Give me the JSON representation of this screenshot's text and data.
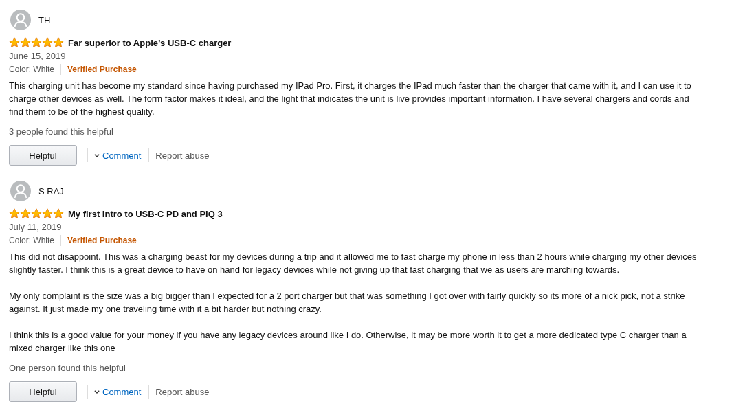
{
  "reviews": [
    {
      "reviewer": "TH",
      "stars": 5,
      "title": "Far superior to Apple’s USB-C charger",
      "date": "June 15, 2019",
      "variant": "Color: White",
      "badge": "Verified Purchase",
      "body": [
        "This charging unit has become my standard since having purchased my IPad Pro. First, it charges the IPad much faster than the charger that came with it, and I can use it to charge other devices as well. The form factor makes it ideal, and the light that indicates the unit is live provides important information. I have several chargers and cords and find them to be of the highest quality."
      ],
      "helpful_count": "3 people found this helpful",
      "helpful_button": "Helpful",
      "comment_link": "Comment",
      "report_link": "Report abuse"
    },
    {
      "reviewer": "S RAJ",
      "stars": 5,
      "title": "My first intro to USB-C PD and PIQ 3",
      "date": "July 11, 2019",
      "variant": "Color: White",
      "badge": "Verified Purchase",
      "body": [
        "This did not disappoint. This was a charging beast for my devices during a trip and it allowed me to fast charge my phone in less than 2 hours while charging my other devices slightly faster. I think this is a great device to have on hand for legacy devices while not giving up that fast charging that we as users are marching towards.",
        "My only complaint is the size was a big bigger than I expected for a 2 port charger but that was something I got over with fairly quickly so its more of a nick pick, not a strike against. It just made my one traveling time with it a bit harder but nothing crazy.",
        "I think this is a good value for your money if you have any legacy devices around like I do. Otherwise, it may be more worth it to get a more dedicated type C charger than a mixed charger like this one"
      ],
      "helpful_count": "One person found this helpful",
      "helpful_button": "Helpful",
      "comment_link": "Comment",
      "report_link": "Report abuse"
    }
  ]
}
